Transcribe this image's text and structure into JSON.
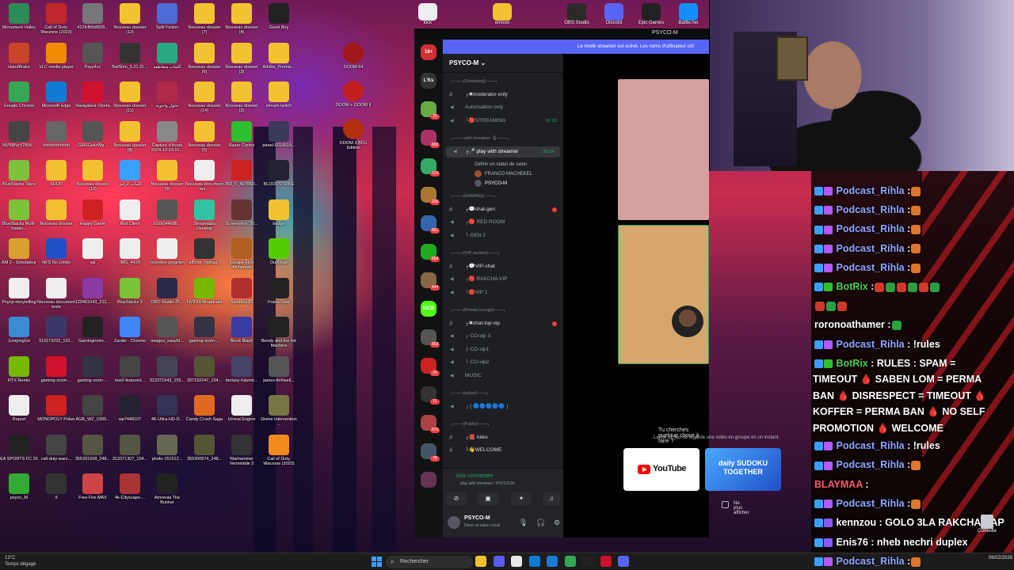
{
  "desktop": {
    "icons": [
      {
        "label": "Monument Valley",
        "color": "#2e8b57"
      },
      {
        "label": "Call of Duty, Warzone (2020)",
        "color": "#c0282d"
      },
      {
        "label": "412fcfb5bf828...",
        "color": "#777"
      },
      {
        "label": "Nouveau dossier (12)",
        "color": "#f2c230"
      },
      {
        "label": "Split Fiction",
        "color": "#4a6cd4"
      },
      {
        "label": "Nouveau dossier (7)",
        "color": "#f2c230"
      },
      {
        "label": "Nouveau dossier (4)",
        "color": "#f2c230"
      },
      {
        "label": "Good Boy",
        "color": "#222"
      },
      {
        "label": "HandBrake",
        "color": "#c8442a"
      },
      {
        "label": "VLC media player",
        "color": "#f08a00"
      },
      {
        "label": "Psyy4cc",
        "color": "#555"
      },
      {
        "label": "BatShm_5.21.21...",
        "color": "#333"
      },
      {
        "label": "كلمات متقاطعة",
        "color": "#2aa882"
      },
      {
        "label": "Nouveau dossier (6)",
        "color": "#f2c230"
      },
      {
        "label": "Nouveau dossier (3)",
        "color": "#f2c230"
      },
      {
        "label": "Adobe_Premie...",
        "color": "#f2c230"
      },
      {
        "label": "Google Chrome",
        "color": "#34a853"
      },
      {
        "label": "Microsoft Edge",
        "color": "#0f7bd4"
      },
      {
        "label": "Navigateur Opera",
        "color": "#d0112b"
      },
      {
        "label": "Nouveau dossier (11)",
        "color": "#f2c230"
      },
      {
        "label": "حلول وأجوبة",
        "color": "#b02a4a"
      },
      {
        "label": "Nouveau dossier (14)",
        "color": "#f2c230"
      },
      {
        "label": "Nouveau dossier (2)",
        "color": "#f2c230"
      },
      {
        "label": "stream twitch",
        "color": "#f2c230"
      },
      {
        "label": "MV5BNzY2NW...",
        "color": "#444"
      },
      {
        "label": "hhhhhhhhhhh",
        "color": "#666"
      },
      {
        "label": "GMXGwlzWg...",
        "color": "#555"
      },
      {
        "label": "Nouveau dossier (8)",
        "color": "#f2c230"
      },
      {
        "label": "Capture d'écran 2024-12-23 01...",
        "color": "#888"
      },
      {
        "label": "Nouveau dossier (5)",
        "color": "#f2c230"
      },
      {
        "label": "Razer Cortex",
        "color": "#2ec02e"
      },
      {
        "label": "panel-5014514...",
        "color": "#3a3a5a"
      },
      {
        "label": "BlueStacks Store",
        "color": "#7cc23a"
      },
      {
        "label": "SHOP",
        "color": "#f2c230"
      },
      {
        "label": "Nouveau dossier (10)",
        "color": "#f2c230"
      },
      {
        "label": "كلمات كراش",
        "color": "#3aa0ff"
      },
      {
        "label": "Nouveau dossier (9)",
        "color": "#f2c230"
      },
      {
        "label": "Nouveau document tex...",
        "color": "#eee"
      },
      {
        "label": "360_F_40788D...",
        "color": "#c22"
      },
      {
        "label": "BLOODSTRIKE",
        "color": "#223"
      },
      {
        "label": "BlueStacks Multi-Instan...",
        "color": "#7cc23a"
      },
      {
        "label": "Nouveau dossier",
        "color": "#f2c230"
      },
      {
        "label": "Happy Game",
        "color": "#c22"
      },
      {
        "label": "Riot Client",
        "color": "#eee"
      },
      {
        "label": "b2db044b8b...",
        "color": "#555"
      },
      {
        "label": "Streamlabs Desktop",
        "color": "#31c3a2"
      },
      {
        "label": "Screenshot_20...",
        "color": "#633"
      },
      {
        "label": "badge",
        "color": "#f2c230"
      },
      {
        "label": "AM 2 - Simulateur ...",
        "color": "#d8a030"
      },
      {
        "label": "NFS No Limits",
        "color": "#2050c8"
      },
      {
        "label": "val",
        "color": "#eee"
      },
      {
        "label": "IMG_4429",
        "color": "#eee"
      },
      {
        "label": "incentive program",
        "color": "#eee"
      },
      {
        "label": "affiche_hamaa_",
        "color": "#333"
      },
      {
        "label": "Escape First Alchemist",
        "color": "#b06020"
      },
      {
        "label": "Duolingo",
        "color": "#58cc02"
      },
      {
        "label": "Psycp-storytelling",
        "color": "#eee"
      },
      {
        "label": "Nouveau document texte",
        "color": "#eee"
      },
      {
        "label": "129401043_212...",
        "color": "#8a3aa0"
      },
      {
        "label": "BlueStacks 5",
        "color": "#7cc23a"
      },
      {
        "label": "OBS-Studio-25...",
        "color": "#2a2a4a"
      },
      {
        "label": "NVIDIA Broadcast",
        "color": "#76b900"
      },
      {
        "label": "Sandbox3D",
        "color": "#b03030"
      },
      {
        "label": "FrameView",
        "color": "#222"
      },
      {
        "label": "JumpingGo",
        "color": "#3a8ad4"
      },
      {
        "label": "313273292_152...",
        "color": "#3a3a6a"
      },
      {
        "label": "Gamingroom...",
        "color": "#222"
      },
      {
        "label": "Zarabi - Chrome",
        "color": "#4285f4"
      },
      {
        "label": "images_easybl...",
        "color": "#555"
      },
      {
        "label": "gaming-room-...",
        "color": "#334"
      },
      {
        "label": "Block Blast!",
        "color": "#3a3aa0"
      },
      {
        "label": "Bendy and the Ink Machine",
        "color": "#222"
      },
      {
        "label": "RTX Remix",
        "color": "#76b900"
      },
      {
        "label": "gaming-room-...",
        "color": "#d0112b"
      },
      {
        "label": "gaming-room-...",
        "color": "#334"
      },
      {
        "label": "mw2-featured...",
        "color": "#444"
      },
      {
        "label": "313371943_155...",
        "color": "#445"
      },
      {
        "label": "287192247_154...",
        "color": "#553"
      },
      {
        "label": "fantasy-futurist...",
        "color": "#446"
      },
      {
        "label": "james-thirlwell...",
        "color": "#555"
      },
      {
        "label": "Report",
        "color": "#eee"
      },
      {
        "label": "MONOPOLY Poker",
        "color": "#c22"
      },
      {
        "label": "AGB_WZ_0309...",
        "color": "#444"
      },
      {
        "label": "wp7448107",
        "color": "#223"
      },
      {
        "label": "4K-Ultra-HD-D...",
        "color": "#335"
      },
      {
        "label": "Candy Crush Saga",
        "color": "#e06a20"
      },
      {
        "label": "Unreal Engine",
        "color": "#eee"
      },
      {
        "label": "Divine Intervention ...",
        "color": "#774"
      },
      {
        "label": "EA SPORTS FC 26",
        "color": "#222"
      },
      {
        "label": "call-duty-warz...",
        "color": "#444"
      },
      {
        "label": "355331508_248...",
        "color": "#554"
      },
      {
        "label": "313371307_154...",
        "color": "#554"
      },
      {
        "label": "photo-151512...",
        "color": "#665"
      },
      {
        "label": "355300874_248...",
        "color": "#553"
      },
      {
        "label": "Warhammer Vermintide 2",
        "color": "#333"
      },
      {
        "label": "Call of Duty, Warzone (2020)",
        "color": "#f28a20"
      },
      {
        "label": "psyco_M",
        "color": "#3a3"
      },
      {
        "label": "9",
        "color": "#333"
      },
      {
        "label": "Free Fire MAX",
        "color": "#c44"
      },
      {
        "label": "4k-Cityscape-...",
        "color": "#a33"
      },
      {
        "label": "Amnesia The Bunker",
        "color": "#222"
      }
    ],
    "mid_icons": [
      {
        "label": "DOOM 64",
        "color": "#a01818"
      },
      {
        "label": "DOOM + DOOM II",
        "color": "#c02020"
      },
      {
        "label": "DOOM 3 BFG Edition",
        "color": "#b03010"
      }
    ],
    "top_icons": [
      {
        "label": "kick",
        "color": "#eee"
      },
      {
        "label": "emooo",
        "color": "#f2c230"
      },
      {
        "label": "OBS Studio",
        "color": "#2a2a2a"
      },
      {
        "label": "Discord",
        "color": "#5865f2"
      },
      {
        "label": "Epic Games",
        "color": "#222"
      },
      {
        "label": "Battle.net",
        "color": "#148eff"
      }
    ],
    "corbeille": "Corbeille"
  },
  "discord": {
    "window_title": "PSYCO-M",
    "streamer_banner": "Le mode streamer est activé. Les noms d'utilisateur ont",
    "server_name": "PSYCO-M ⌄",
    "guilds": [
      {
        "label": "18+",
        "color": "#d23030",
        "badge": ""
      },
      {
        "label": "L'Ks",
        "color": "#333",
        "badge": ""
      },
      {
        "label": "",
        "color": "#6a4",
        "badge": "26"
      },
      {
        "label": "",
        "color": "#a36",
        "badge": "692"
      },
      {
        "label": "",
        "color": "#3a6",
        "badge": "174"
      },
      {
        "label": "",
        "color": "#a73",
        "badge": "106"
      },
      {
        "label": "",
        "color": "#36a",
        "badge": "561"
      },
      {
        "label": "",
        "color": "#2a2",
        "badge": "654"
      },
      {
        "label": "",
        "color": "#864",
        "badge": "444"
      },
      {
        "label": "KICK",
        "color": "#53fc18",
        "badge": ""
      },
      {
        "label": "",
        "color": "#555",
        "badge": "563"
      },
      {
        "label": "",
        "color": "#c22",
        "badge": "25"
      },
      {
        "label": "",
        "color": "#333",
        "badge": "11"
      },
      {
        "label": "",
        "color": "#a44",
        "badge": "573"
      },
      {
        "label": "",
        "color": "#456",
        "badge": "78"
      },
      {
        "label": "",
        "color": "#635",
        "badge": ""
      }
    ],
    "channels": [
      {
        "kind": "cat",
        "label": "┌───{Streaming}───┐"
      },
      {
        "kind": "txt",
        "label": "┌✖moderator-only"
      },
      {
        "kind": "voice",
        "label": "Autorisation only"
      },
      {
        "kind": "voice",
        "label": "└🔴STREAMING",
        "time": "00 02"
      },
      {
        "kind": "cat",
        "label": "┌─── with streamer 🎙───┐"
      },
      {
        "kind": "active",
        "label": "┌🎤 play with streamer",
        "time": "28:24"
      },
      {
        "kind": "cat",
        "label": "┌───{GAMING}───┐"
      },
      {
        "kind": "txt",
        "label": "┌💬chat-gen",
        "unread": true
      },
      {
        "kind": "voice",
        "label": "┌🔴 RED ROOM"
      },
      {
        "kind": "voice",
        "label": "└ GEN 2"
      },
      {
        "kind": "cat",
        "label": "┌───{VIP section}───┐"
      },
      {
        "kind": "txt",
        "label": "┌💬VIP-chat"
      },
      {
        "kind": "voice",
        "label": "┌🔴 RAKCHA VIP"
      },
      {
        "kind": "voice",
        "label": "└🔴VIP 1"
      },
      {
        "kind": "cat",
        "label": "┌───{Private lounge}───┐"
      },
      {
        "kind": "txt",
        "label": "┌✖chat-top-vip",
        "unread": true
      },
      {
        "kind": "voice",
        "label": "┌ CO-vip 3"
      },
      {
        "kind": "voice",
        "label": "├ CO-vip1"
      },
      {
        "kind": "voice",
        "label": "└ CO-vip2"
      },
      {
        "kind": "voice",
        "label": "MUSIC"
      },
      {
        "kind": "cat",
        "label": "┌───{salon}───┐"
      },
      {
        "kind": "voice",
        "label": "┌ [ 🔵🔵🔵🔵🔵 ]"
      },
      {
        "kind": "cat",
        "label": "┌───{Public}───┐"
      },
      {
        "kind": "txt",
        "label": "┌📕 rules"
      },
      {
        "kind": "txt",
        "label": "└👋WELCOME"
      }
    ],
    "voice_status_hint": "Définir un statut de salon",
    "voice_users": [
      "FRANCO MACHEKEL",
      "PSYCO-M"
    ],
    "voice_connected": "Voix connectée",
    "voice_channel_path": "play with streamer / PSYCO-M",
    "user_name": "PSYCO-M",
    "user_status": "Dans un salon vocal",
    "activity_title": "Tu cherches quelque chose à faire ?",
    "activity_sub": "Lance un jeu ou regarde une vidéo en groupe en un instant.",
    "youtube_label": "YouTube",
    "sudoku_label": "daily SUDOKU TOGETHER",
    "dont_show": "Ne plus afficher"
  },
  "chat": {
    "messages": [
      {
        "user": "Podcast_Rihla",
        "type": "pod",
        "text": ":",
        "emotes": 1
      },
      {
        "user": "Podcast_Rihla",
        "type": "pod",
        "text": ":",
        "emotes": 1
      },
      {
        "user": "Podcast_Rihla",
        "type": "pod",
        "text": ":",
        "emotes": 1
      },
      {
        "user": "Podcast_Rihla",
        "type": "pod",
        "text": ":",
        "emotes": 1
      },
      {
        "user": "Podcast_Rihla",
        "type": "pod",
        "text": ":",
        "emotes": 1
      },
      {
        "user": "BotRix",
        "type": "bot",
        "text": ":",
        "emotes": 6
      },
      {
        "user": "",
        "type": "cont",
        "text": "",
        "emotes": 3
      },
      {
        "user": "roronoathamer",
        "type": "plain",
        "text": ":",
        "emotes": 1
      },
      {
        "user": "Podcast_Rihla",
        "type": "pod",
        "text": ": !rules",
        "emotes": 0
      },
      {
        "user": "BotRix",
        "type": "bot",
        "text": ": RULES : SPAM =",
        "emotes": 0
      }
    ],
    "rules_lines": [
      "TIMEOUT 🩸 SABEN LOM = PERMA",
      "BAN 🩸 DISRESPECT = TIMEOUT 🩸",
      "KOFFER = PERMA BAN 🩸 NO SELF",
      "PROMOTION 🩸 WELCOME"
    ],
    "messages2": [
      {
        "user": "Podcast_Rihla",
        "type": "pod",
        "text": ": !rules",
        "emotes": 0
      },
      {
        "user": "Podcast_Rihla",
        "type": "pod",
        "text": ":",
        "emotes": 1
      },
      {
        "user": "BLAYMAA",
        "type": "red",
        "text": ":",
        "emotes": 0
      },
      {
        "user": "Podcast_Rihla",
        "type": "pod",
        "text": ":",
        "emotes": 1
      },
      {
        "user": "kennzou",
        "type": "plain2",
        "text": ": GOLO 3LA RAKCHA RAP",
        "emotes": 0
      },
      {
        "user": "Enis76",
        "type": "plain2",
        "text": ": nheb nechri duplex",
        "emotes": 0
      },
      {
        "user": "Podcast_Rihla",
        "type": "pod",
        "text": ":",
        "emotes": 1
      }
    ]
  },
  "taskbar": {
    "weather_temp": "13°C",
    "weather_desc": "Temps dégagé",
    "search_placeholder": "Rechercher",
    "clock_time": "",
    "clock_date": "06/02/2026",
    "apps": [
      "#f2c230",
      "#5a5aff",
      "#e8e8e8",
      "#0f7bd4",
      "#1a7ad4",
      "#34a853",
      "#222",
      "#d0112b",
      "#5865f2"
    ]
  }
}
